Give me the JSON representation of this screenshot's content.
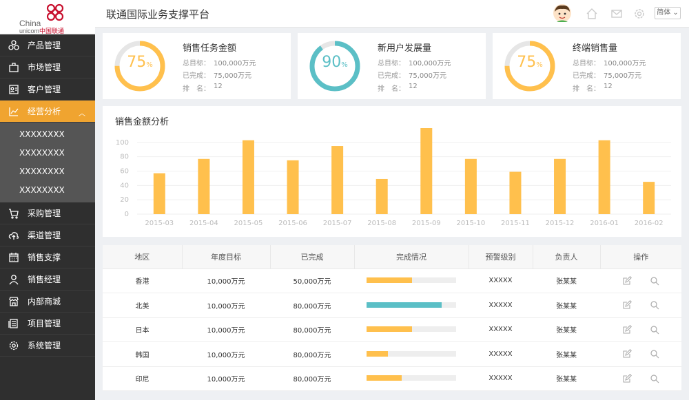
{
  "brand": {
    "line1": "China",
    "line2a": "unicom",
    "line2b": "中国联通"
  },
  "header": {
    "title": "联通国际业务支撑平台",
    "lang": "简体 ⌄"
  },
  "sidebar": {
    "items": [
      {
        "label": "产品管理",
        "icon": "cube-icon"
      },
      {
        "label": "市场管理",
        "icon": "briefcase-icon"
      },
      {
        "label": "客户管理",
        "icon": "contact-card-icon"
      },
      {
        "label": "经营分析",
        "icon": "trend-chart-icon",
        "active": true
      },
      {
        "label": "采购管理",
        "icon": "cart-icon"
      },
      {
        "label": "渠道管理",
        "icon": "cloud-upload-icon"
      },
      {
        "label": "销售支撑",
        "icon": "calendar-icon"
      },
      {
        "label": "销售经理",
        "icon": "person-icon"
      },
      {
        "label": "内部商城",
        "icon": "store-icon"
      },
      {
        "label": "项目管理",
        "icon": "document-icon"
      },
      {
        "label": "系统管理",
        "icon": "gear-icon"
      }
    ],
    "submenu": [
      "XXXXXXXX",
      "XXXXXXXX",
      "XXXXXXXX",
      "XXXXXXXX"
    ]
  },
  "colors": {
    "accent": "#f0a430",
    "teal": "#5bbfc6",
    "yellow": "#ffc04d",
    "sidebar": "#2f2f2f"
  },
  "cards": [
    {
      "title": "销售任务金额",
      "percent": 75,
      "pct_text": "75",
      "unit": "%",
      "color": "#ffc04d",
      "target_label": "总目标：",
      "target": "100,000万元",
      "done_label": "已完成：",
      "done": "75,000万元",
      "rank_label": "排　名：",
      "rank": "12"
    },
    {
      "title": "新用户发展量",
      "percent": 90,
      "pct_text": "90",
      "unit": "%",
      "color": "#5bbfc6",
      "target_label": "总目标：",
      "target": "100,000万元",
      "done_label": "已完成：",
      "done": "75,000万元",
      "rank_label": "排　名：",
      "rank": "12"
    },
    {
      "title": "终端销售量",
      "percent": 75,
      "pct_text": "75",
      "unit": "%",
      "color": "#ffc04d",
      "target_label": "总目标：",
      "target": "100,000万元",
      "done_label": "已完成：",
      "done": "75,000万元",
      "rank_label": "排　名：",
      "rank": "12"
    }
  ],
  "chart_data": {
    "type": "bar",
    "title": "销售金额分析",
    "categories": [
      "2015-03",
      "2015-04",
      "2015-05",
      "2015-06",
      "2015-07",
      "2015-08",
      "2015-09",
      "2015-10",
      "2015-11",
      "2015-12",
      "2016-01",
      "2016-02"
    ],
    "values": [
      57,
      77,
      103,
      75,
      95,
      49,
      120,
      77,
      59,
      77,
      103,
      45
    ],
    "yticks": [
      "0",
      "20",
      "40",
      "60",
      "80",
      "100"
    ],
    "ylim": [
      0,
      120
    ],
    "color": "#ffc04d",
    "grid": true
  },
  "table": {
    "headers": [
      "地区",
      "年度目标",
      "已完成",
      "完成情况",
      "预警级别",
      "负责人",
      "操作"
    ],
    "rows": [
      {
        "region": "香港",
        "target": "10,000万元",
        "done": "50,000万元",
        "progress": 0.51,
        "color": "#ffc04d",
        "level": "XXXXX",
        "owner": "张某某"
      },
      {
        "region": "北美",
        "target": "10,000万元",
        "done": "80,000万元",
        "progress": 0.84,
        "color": "#5bbfc6",
        "level": "XXXXX",
        "owner": "张某某"
      },
      {
        "region": "日本",
        "target": "10,000万元",
        "done": "80,000万元",
        "progress": 0.51,
        "color": "#ffc04d",
        "level": "XXXXX",
        "owner": "张某某"
      },
      {
        "region": "韩国",
        "target": "10,000万元",
        "done": "80,000万元",
        "progress": 0.24,
        "color": "#ffc04d",
        "level": "XXXXX",
        "owner": "张某某"
      },
      {
        "region": "印尼",
        "target": "10,000万元",
        "done": "80,000万元",
        "progress": 0.39,
        "color": "#ffc04d",
        "level": "XXXXX",
        "owner": "张某某"
      }
    ]
  }
}
